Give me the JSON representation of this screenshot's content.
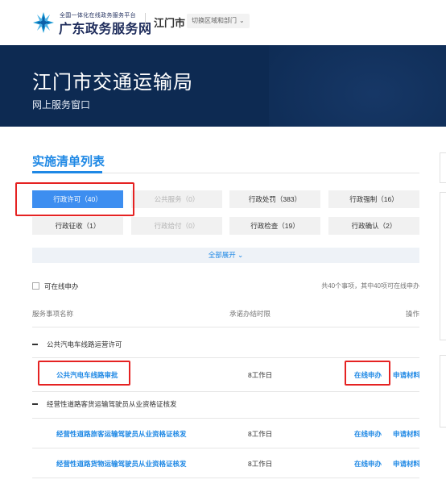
{
  "header": {
    "platform_small": "全国一体化在线政务服务平台",
    "platform_name": "广东政务服务网",
    "city": "江门市",
    "switch_region": "切换区域和部门"
  },
  "banner": {
    "title": "江门市交通运输局",
    "subtitle": "网上服务窗口"
  },
  "section": {
    "title": "实施清单列表"
  },
  "categories": [
    {
      "label": "行政许可（40）",
      "state": "active"
    },
    {
      "label": "公共服务（0）",
      "state": "disabled"
    },
    {
      "label": "行政处罚（383）",
      "state": "normal"
    },
    {
      "label": "行政强制（16）",
      "state": "normal"
    },
    {
      "label": "行政征收（1）",
      "state": "normal"
    },
    {
      "label": "行政给付（0）",
      "state": "disabled"
    },
    {
      "label": "行政检查（19）",
      "state": "normal"
    },
    {
      "label": "行政确认（2）",
      "state": "normal"
    }
  ],
  "expand_all": "全部展开",
  "filter": {
    "online_only": "可在线申办",
    "summary": "共40个事项，其中40项可在线申办"
  },
  "table": {
    "columns": [
      "服务事项名称",
      "承诺办结时限",
      "操作"
    ],
    "groups": [
      {
        "name": "公共汽电车线路运营许可",
        "items": [
          {
            "name": "公共汽电车线路审批",
            "limit": "8工作日",
            "online": "在线申办",
            "material": "申请材料"
          }
        ]
      },
      {
        "name": "经营性道路客货运输驾驶员从业资格证核发",
        "items": [
          {
            "name": "经营性道路旅客运输驾驶员从业资格证核发",
            "limit": "8工作日",
            "online": "在线申办",
            "material": "申请材料"
          },
          {
            "name": "经营性道路货物运输驾驶员从业资格证核发",
            "limit": "8工作日",
            "online": "在线申办",
            "material": "申请材料"
          }
        ]
      }
    ]
  },
  "colors": {
    "brand_navy": "#1f2d5c",
    "banner_bg": "#0d2a52",
    "accent_blue": "#1e88e5",
    "active_tab": "#3d8ef0",
    "highlight_red": "#e52222"
  },
  "icons": {
    "logo": "starburst-logo-icon",
    "switch": "chevron-down-icon",
    "expand": "chevron-down-icon",
    "group_toggle": "minus-icon"
  }
}
